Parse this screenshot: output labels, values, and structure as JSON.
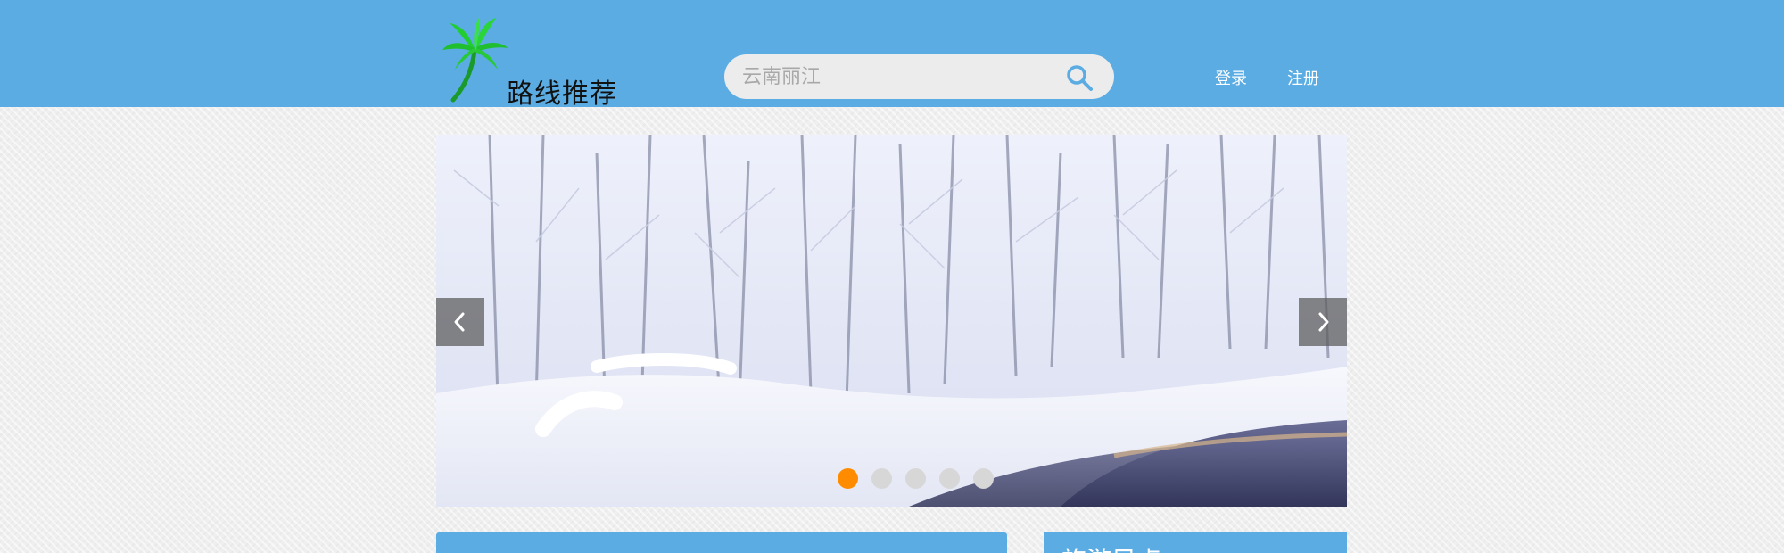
{
  "header": {
    "logo_text": "路线推荐",
    "search": {
      "placeholder": "云南丽江",
      "value": ""
    },
    "nav": {
      "login": "登录",
      "register": "注册"
    }
  },
  "carousel": {
    "current_slide": 1,
    "slide_count": 5,
    "image_subject": "snowy forest with a winding river"
  },
  "panels": {
    "right_title": "旅游目点"
  },
  "colors": {
    "header_bg": "#5aace3",
    "accent_active_dot": "#ff8c00",
    "inactive_dot": "#d7d7d7",
    "logo_palm": "#22cc33"
  }
}
